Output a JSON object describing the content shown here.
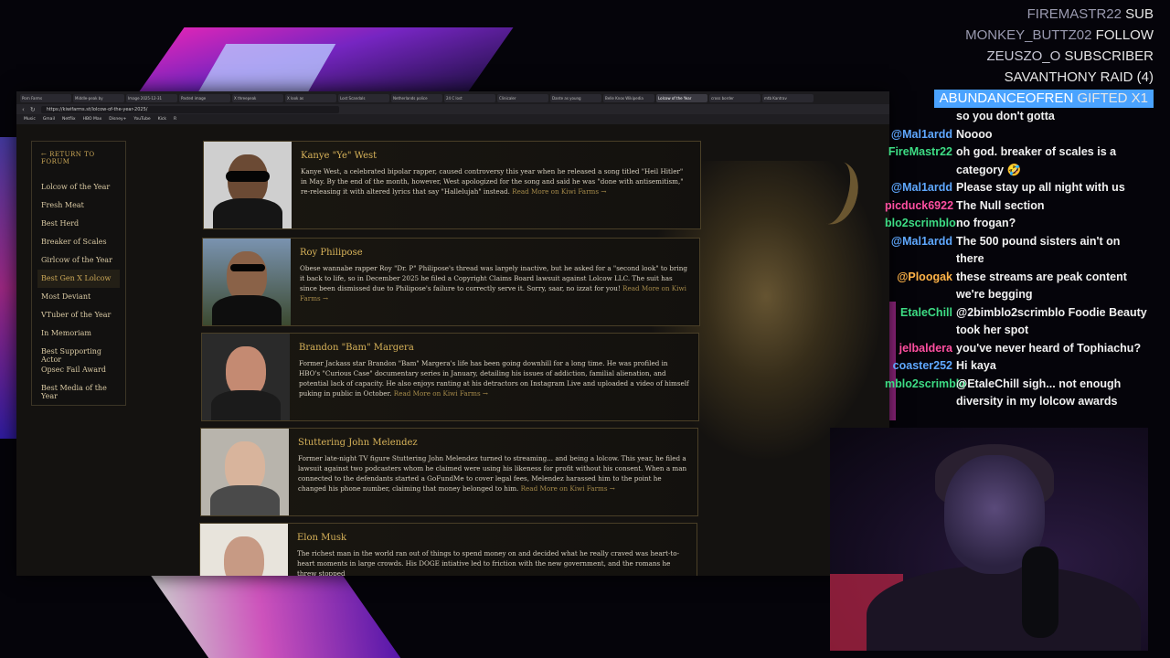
{
  "browser": {
    "tabs": [
      "Porn Farms",
      "Middle-peak by",
      "Image 2025-12-31",
      "Pasted image",
      "X threepeak",
      "X look as",
      "Lost Scandals",
      "Netherlands police",
      "24 C lost",
      "Clinicaler",
      "Dante as young",
      "Belle Knox Wikipedia",
      "Lolcow of the Year",
      "cross border",
      "mtb Kantrav"
    ],
    "active_tab_index": 12,
    "url": "https://kiwifarms.st/lolcow-of-the-year-2025/",
    "bookmarks": [
      "Music",
      "Gmail",
      "Netflix",
      "HBO Max",
      "Disney+",
      "YouTube",
      "Kick",
      "R"
    ]
  },
  "sidebar": {
    "return_label": "← RETURN TO FORUM",
    "items": [
      {
        "label": "Lolcow of the Year"
      },
      {
        "label": "Fresh Meat"
      },
      {
        "label": "Best Herd"
      },
      {
        "label": "Breaker of Scales"
      },
      {
        "label": "Girlcow of the Year"
      },
      {
        "label": "Best Gen X Lolcow",
        "active": true
      },
      {
        "label": "Most Deviant"
      },
      {
        "label": "VTuber of the Year"
      },
      {
        "label": "In Memoriam"
      },
      {
        "label": "Best Supporting Actor"
      },
      {
        "label": "Opsec Fail Award"
      },
      {
        "label": "Best Media of the Year"
      }
    ]
  },
  "entries": [
    {
      "name": "Kanye \"Ye\" West",
      "desc": "Kanye West, a celebrated bipolar rapper, caused controversy this year when he released a song titled \"Heil Hitler\" in May. By the end of the month, however, West apologized for the song and said he was \"done with antisemitism,\" re-releasing it with altered lyrics that say \"Hallelujah\" instead.",
      "more": "Read More on Kiwi Farms →"
    },
    {
      "name": "Roy Philipose",
      "desc": "Obese wannabe rapper Roy \"Dr. P\" Philipose's thread was largely inactive, but he asked for a \"second look\" to bring it back to life, so in December 2025 he filed a Copyright Claims Board lawsuit against Lolcow LLC. The suit has since been dismissed due to Philipose's failure to correctly serve it. Sorry, saar, no izzat for you!",
      "more": "Read More on Kiwi Farms →"
    },
    {
      "name": "Brandon \"Bam\" Margera",
      "desc": "Former Jackass star Brandon \"Bam\" Margera's life has been going downhill for a long time. He was profiled in HBO's \"Curious Case\" documentary series in January, detailing his issues of addiction, familial alienation, and potential lack of capacity. He also enjoys ranting at his detractors on Instagram Live and uploaded a video of himself puking in public in October.",
      "more": "Read More on Kiwi Farms →"
    },
    {
      "name": "Stuttering John Melendez",
      "desc": "Former late-night TV figure Stuttering John Melendez turned to streaming... and being a lolcow. This year, he filed a lawsuit against two podcasters whom he claimed were using his likeness for profit without his consent. When a man connected to the defendants started a GoFundMe to cover legal fees, Melendez harassed him to the point he changed his phone number, claiming that money belonged to him.",
      "more": "Read More on Kiwi Farms →"
    },
    {
      "name": "Elon Musk",
      "desc": "The richest man in the world ran out of things to spend money on and decided what he really craved was heart-to-heart moments in large crowds. His DOGE intiative led to friction with the new government, and the romans he threw stopped",
      "more": ""
    }
  ],
  "alerts": [
    {
      "user": "FIREMASTR22",
      "tag": "SUB"
    },
    {
      "user": "MONKEY_BUTTZ02",
      "tag": "FOLLOW"
    },
    {
      "user": "ZEUSZO_O",
      "tag": "SUBSCRIBER"
    },
    {
      "user": "SAVANTHONY",
      "tag": "RAID (4)"
    },
    {
      "user": "ABUNDANCEOFREN",
      "tag": "GIFTED X1"
    }
  ],
  "chat": [
    {
      "user": "",
      "text": "so you don't gotta",
      "color": "#ffffff"
    },
    {
      "user": "@Mal1ardd",
      "text": "Noooo",
      "color": "#5fa8ff"
    },
    {
      "user": "FireMastr22",
      "text": "oh god. breaker of scales is a category 🤣",
      "color": "#3ddc84"
    },
    {
      "user": "@Mal1ardd",
      "text": "Please stay up all night with us",
      "color": "#5fa8ff"
    },
    {
      "user": "picduck6922",
      "text": "The Null section",
      "color": "#ff4fa0"
    },
    {
      "user": "blo2scrimblo",
      "text": "no frogan?",
      "color": "#3ddc84"
    },
    {
      "user": "@Mal1ardd",
      "text": "The 500 pound sisters ain't on there",
      "color": "#5fa8ff"
    },
    {
      "user": "@Ploogak",
      "text": "these streams are peak content we're begging",
      "color": "#ffb347"
    },
    {
      "user": "EtaleChill",
      "text": "@2bimblo2scrimblo Foodie Beauty took her spot",
      "color": "#3ddc84"
    },
    {
      "user": "jelbaldera",
      "text": "you've never heard of Tophiachu?",
      "color": "#ff4fa0"
    },
    {
      "user": "coaster252",
      "text": "Hi kaya",
      "color": "#5fa8ff"
    },
    {
      "user": "mblo2scrimblo",
      "text": "@EtaleChill sigh... not enough diversity in my lolcow awards",
      "color": "#3ddc84"
    }
  ]
}
